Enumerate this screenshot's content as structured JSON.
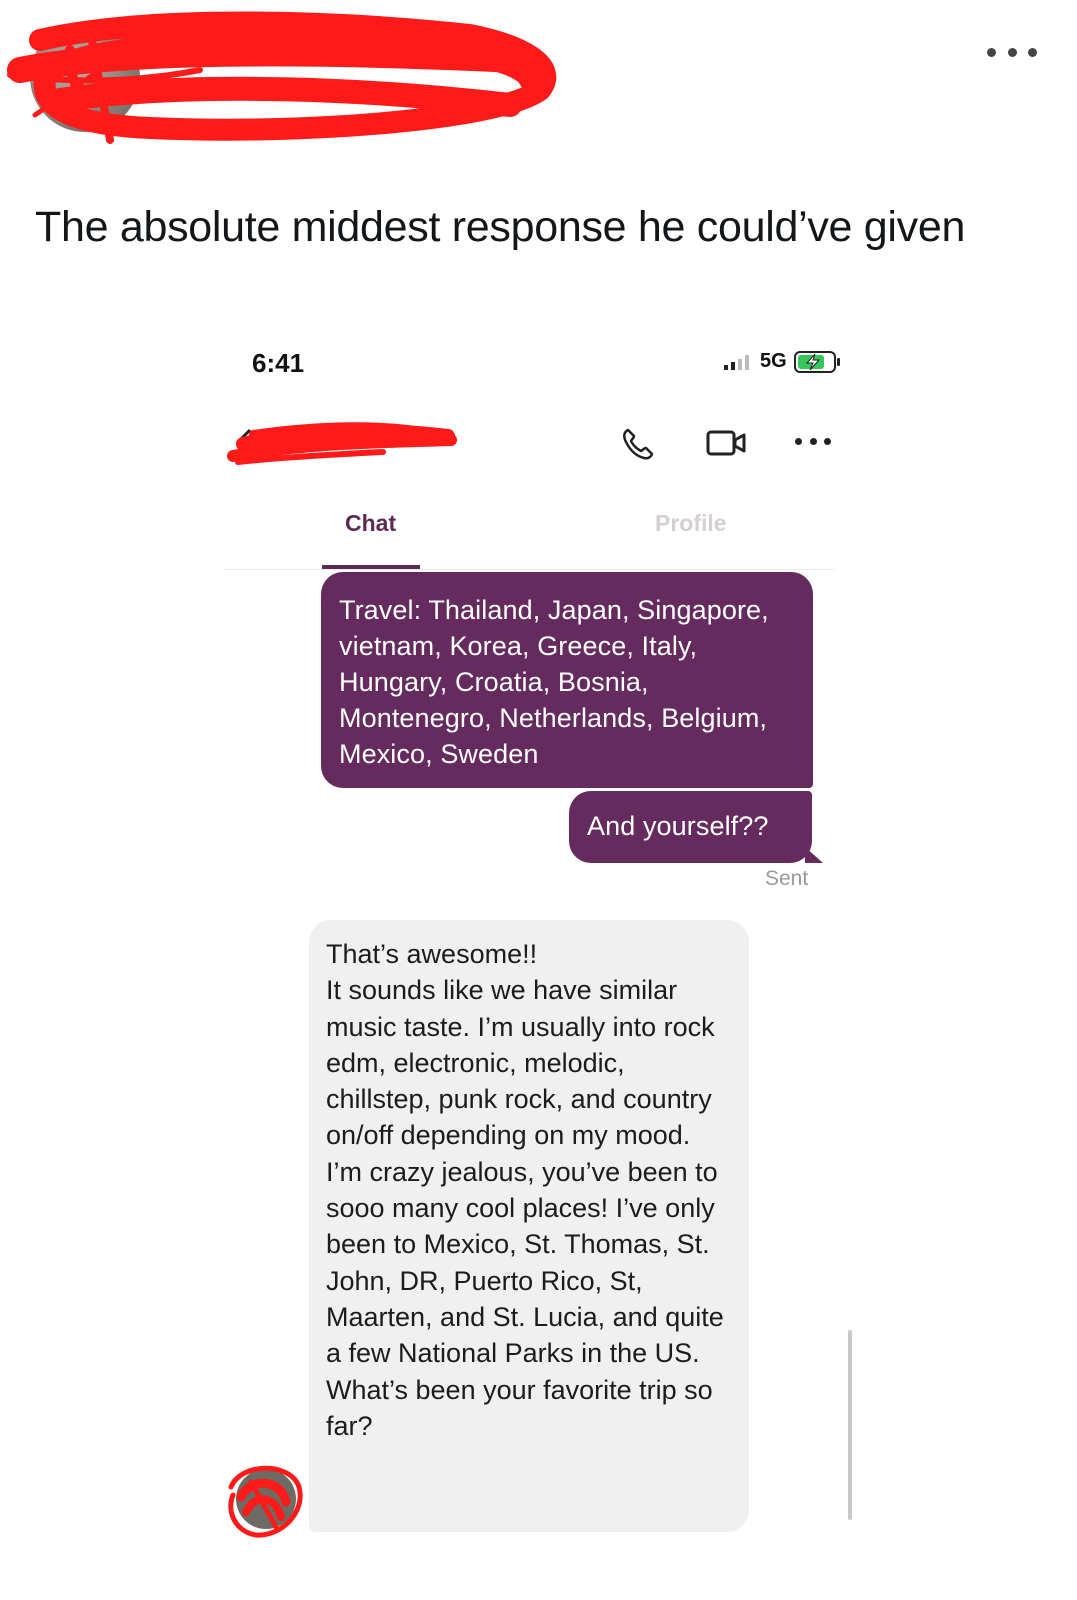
{
  "post": {
    "text": "The absolute middest response he could’ve given",
    "more_icon": "ellipsis-horizontal",
    "redaction_color": "#ff1a1a"
  },
  "phone": {
    "status_bar": {
      "time": "6:41",
      "network": "5G",
      "signal_icon": "signal-bars",
      "battery_icon": "battery-charging"
    },
    "nav": {
      "back_icon": "chevron-left",
      "call_icon": "phone",
      "video_icon": "video-camera",
      "more_icon": "ellipsis-horizontal"
    },
    "tabs": [
      {
        "label": "Chat",
        "active": true
      },
      {
        "label": "Profile",
        "active": false
      }
    ],
    "accent_color": "#652b5e",
    "messages": {
      "outgoing_1": "Travel: Thailand, Japan, Singapore, vietnam, Korea, Greece, Italy, Hungary, Croatia, Bosnia, Montenegro, Netherlands, Belgium, Mexico, Sweden",
      "outgoing_2": "And yourself??",
      "sent_status": "Sent",
      "incoming_lines": [
        "That’s awesome!!",
        "It sounds like we have similar music taste. I’m usually into rock edm, electronic, melodic, chillstep, punk rock, and country on/off depending on my mood.",
        "I’m crazy jealous, you’ve been to sooo many cool places! I’ve only been to Mexico, St. Thomas, St. John, DR, Puerto Rico, St, Maarten, and St. Lucia, and quite a few National Parks in the US.",
        "What’s been your favorite trip so far?"
      ]
    }
  }
}
